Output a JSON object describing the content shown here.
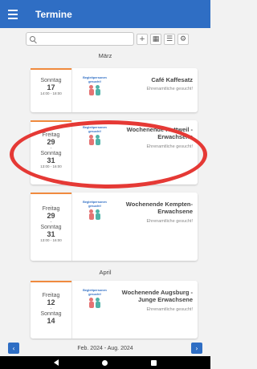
{
  "appbar": {
    "title": "Termine"
  },
  "toolbar": {
    "search_placeholder": "",
    "buttons": [
      "+",
      "▦",
      "☰",
      "⚙"
    ]
  },
  "sections": {
    "march": "März",
    "april": "April"
  },
  "image_caption": "Begleitpersonen gesucht!",
  "cards": [
    {
      "day1": "Sonntag",
      "num1": "17",
      "time": "14:00 - 18:00",
      "title": "Café Kaffesatz",
      "subtitle": "Ehrenamtliche gesucht!"
    },
    {
      "day1": "Freitag",
      "num1": "29",
      "dash": "-",
      "day2": "Sonntag",
      "num2": "31",
      "time": "13:00 - 16:00",
      "title": "Wochenende Rottweil - Erwachsene",
      "subtitle": "Ehrenamtliche gesucht!"
    },
    {
      "day1": "Freitag",
      "num1": "29",
      "dash": "-",
      "day2": "Sonntag",
      "num2": "31",
      "time": "13:00 - 16:00",
      "title": "Wochenende Kempten- Erwachsene",
      "subtitle": "Ehrenamtliche gesucht!"
    },
    {
      "day1": "Freitag",
      "num1": "12",
      "dash": "-",
      "day2": "Sonntag",
      "num2": "14",
      "title": "Wochenende Augsburg - Junge Erwachsene",
      "subtitle": "Ehrenamtliche gesucht!"
    }
  ],
  "pager": {
    "prev": "‹",
    "label": "Feb. 2024 - Aug. 2024",
    "next": "›"
  },
  "colors": {
    "primary": "#2f6ec4",
    "accent": "#f08a3e",
    "highlight": "#e53935"
  }
}
